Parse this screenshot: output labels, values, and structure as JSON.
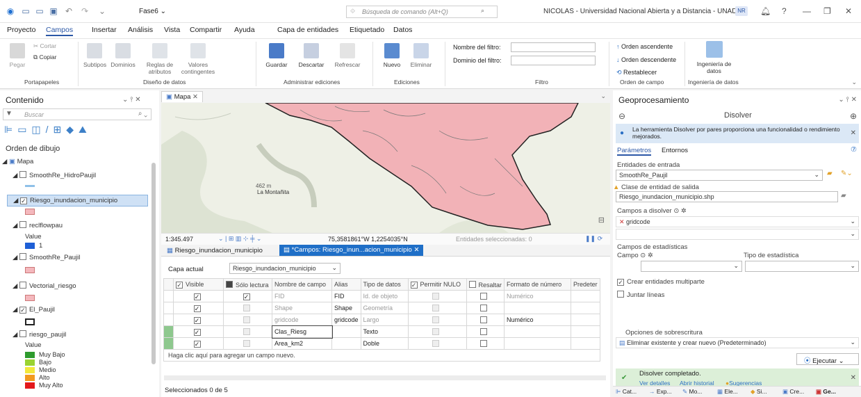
{
  "titlebar": {
    "project": "Fase6 ⌄",
    "search_placeholder": "Búsqueda de comando (Alt+Q)",
    "user": "NICOLAS - Universidad Nacional Abierta y a Distancia - UNAD",
    "initials": "NR"
  },
  "menu": [
    "Proyecto",
    "Campos",
    "Insertar",
    "Análisis",
    "Vista",
    "Compartir",
    "Ayuda"
  ],
  "context_tabs": {
    "title": "Capa de entidades",
    "tabs": [
      "Etiquetado",
      "Datos"
    ]
  },
  "ribbon": {
    "portapapeles": {
      "pegar": "Pegar",
      "cortar": "Cortar",
      "copiar": "Copiar",
      "label": "Portapapeles"
    },
    "diseno": {
      "subtipos": "Subtipos",
      "dominios": "Dominios",
      "reglas": "Reglas de atributos",
      "valores": "Valores contingentes",
      "label": "Diseño de datos"
    },
    "ediciones": {
      "guardar": "Guardar",
      "descartar": "Descartar",
      "refrescar": "Refrescar",
      "label": "Administrar ediciones"
    },
    "edic2": {
      "nuevo": "Nuevo",
      "eliminar": "Eliminar",
      "label": "Ediciones"
    },
    "filtro": {
      "nombre": "Nombre del filtro:",
      "dominio": "Dominio del filtro:",
      "label": "Filtro"
    },
    "orden": {
      "asc": "Orden ascendente",
      "desc": "Orden descendente",
      "restablecer": "Restablecer",
      "label": "Orden de campo"
    },
    "ingenieria": {
      "btn": "Ingeniería de datos",
      "label": "Ingeniería de datos"
    }
  },
  "contents": {
    "title": "Contenido",
    "search_placeholder": "Buscar",
    "draw_order": "Orden de dibujo",
    "map": "Mapa",
    "layers": {
      "l1": "SmoothRe_HidroPaujil",
      "l2": "Riesgo_inundacion_municipio",
      "l3": "reclflowpau",
      "l3_value": "Value",
      "l3_v1": "1",
      "l4": "SmoothRe_Paujil",
      "l5": "Vectorial_riesgo",
      "l6": "El_Paujil",
      "l7": "riesgo_paujil",
      "l7_value": "Value"
    },
    "legend": [
      {
        "label": "Muy Bajo",
        "color": "#2e9b2e"
      },
      {
        "label": "Bajo",
        "color": "#9ad332"
      },
      {
        "label": "Medio",
        "color": "#f3e83b"
      },
      {
        "label": "Alto",
        "color": "#f29a1f"
      },
      {
        "label": "Muy Alto",
        "color": "#e3191c"
      }
    ]
  },
  "map": {
    "tab": "Mapa",
    "label_place": "La Montañita",
    "label_elev": "462 m",
    "scale": "1:345.497",
    "coords": "75,3581861°W 1,2254035°N",
    "selected": "Entidades seleccionadas: 0",
    "fill": "#f2b2b7"
  },
  "table": {
    "tab1": "Riesgo_inundacion_municipio",
    "tab2": "*Campos: Riesgo_inun...acion_municipio",
    "capa_label": "Capa actual",
    "capa_value": "Riesgo_inundacion_municipio",
    "headers": [
      "Visible",
      "Sólo lectura",
      "Nombre de campo",
      "Alias",
      "Tipo de datos",
      "Permitir NULO",
      "Resaltar",
      "Formato de número",
      "Predeter"
    ],
    "rows": [
      {
        "name": "FID",
        "alias": "FID",
        "type": "Id. de objeto",
        "fmt": "Numérico"
      },
      {
        "name": "Shape",
        "alias": "Shape",
        "type": "Geometría",
        "fmt": ""
      },
      {
        "name": "gridcode",
        "alias": "gridcode",
        "type": "Largo",
        "fmt": "Numérico"
      },
      {
        "name": "Clas_Riesg",
        "alias": "",
        "type": "Texto",
        "fmt": ""
      },
      {
        "name": "Area_km2",
        "alias": "",
        "type": "Doble",
        "fmt": ""
      }
    ],
    "add_hint": "Haga clic aquí para agregar un campo nuevo.",
    "status": "Seleccionados 0 de 5"
  },
  "geoproc": {
    "title": "Geoprocesamiento",
    "tool": "Disolver",
    "info": "La herramienta Disolver por pares proporciona una funcionalidad o rendimiento mejorados.",
    "tabs": [
      "Parámetros",
      "Entornos"
    ],
    "entrada_label": "Entidades de entrada",
    "entrada_value": "SmoothRe_Paujil",
    "salida_label": "Clase de entidad de salida",
    "salida_value": "Riesgo_inundacion_municipio.shp",
    "campos_label": "Campos a disolver",
    "campo1": "gridcode",
    "estad_label": "Campos de estadísticas",
    "campo_label": "Campo",
    "tipo_label": "Tipo de estadística",
    "multiparte": "Crear entidades multiparte",
    "juntar": "Juntar líneas",
    "sobrescritura_label": "Opciones de sobrescritura",
    "sobrescritura_value": "Eliminar existente y crear nuevo (Predeterminado)",
    "ejecutar": "Ejecutar",
    "done": "Disolver completado.",
    "links": [
      "Ver detalles",
      "Abrir historial",
      "Sugerencias"
    ],
    "bottom_tabs": [
      "Cat...",
      "Exp...",
      "Mo...",
      "Ele...",
      "Si...",
      "Cre...",
      "Ge..."
    ]
  }
}
